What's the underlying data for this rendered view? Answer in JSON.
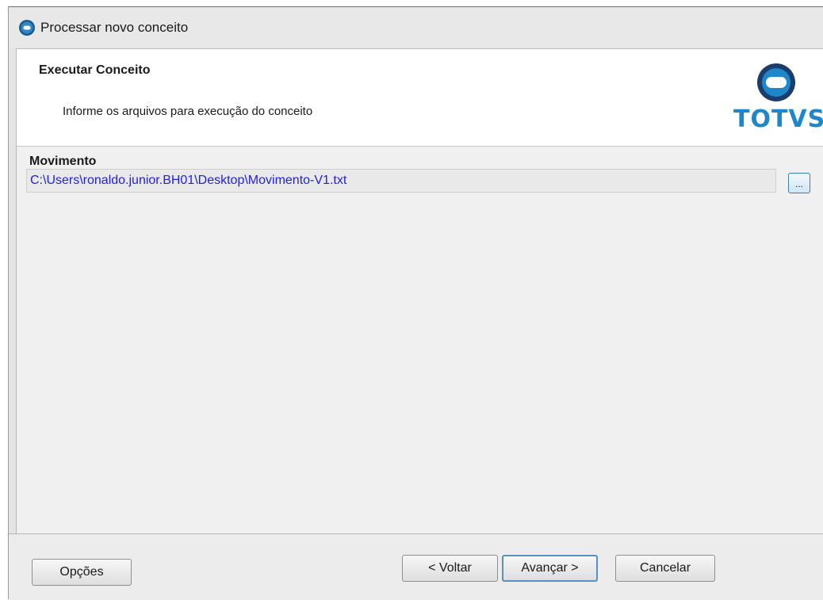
{
  "window": {
    "title": "Processar novo conceito"
  },
  "header": {
    "title": "Executar Conceito",
    "subtitle": "Informe os arquivos para execução do conceito",
    "logo_text": "TOTVS",
    "logo_icon": "totvs-logo-icon",
    "brand_color": "#1e87c9"
  },
  "form": {
    "movimento_label": "Movimento",
    "movimento_value": "C:\\Users\\ronaldo.junior.BH01\\Desktop\\Movimento-V1.txt",
    "browse_label": "...",
    "value_color": "#1f1fe6"
  },
  "footer": {
    "options_label": "Opções",
    "back_label": "< Voltar",
    "next_label": "Avançar >",
    "cancel_label": "Cancelar"
  }
}
